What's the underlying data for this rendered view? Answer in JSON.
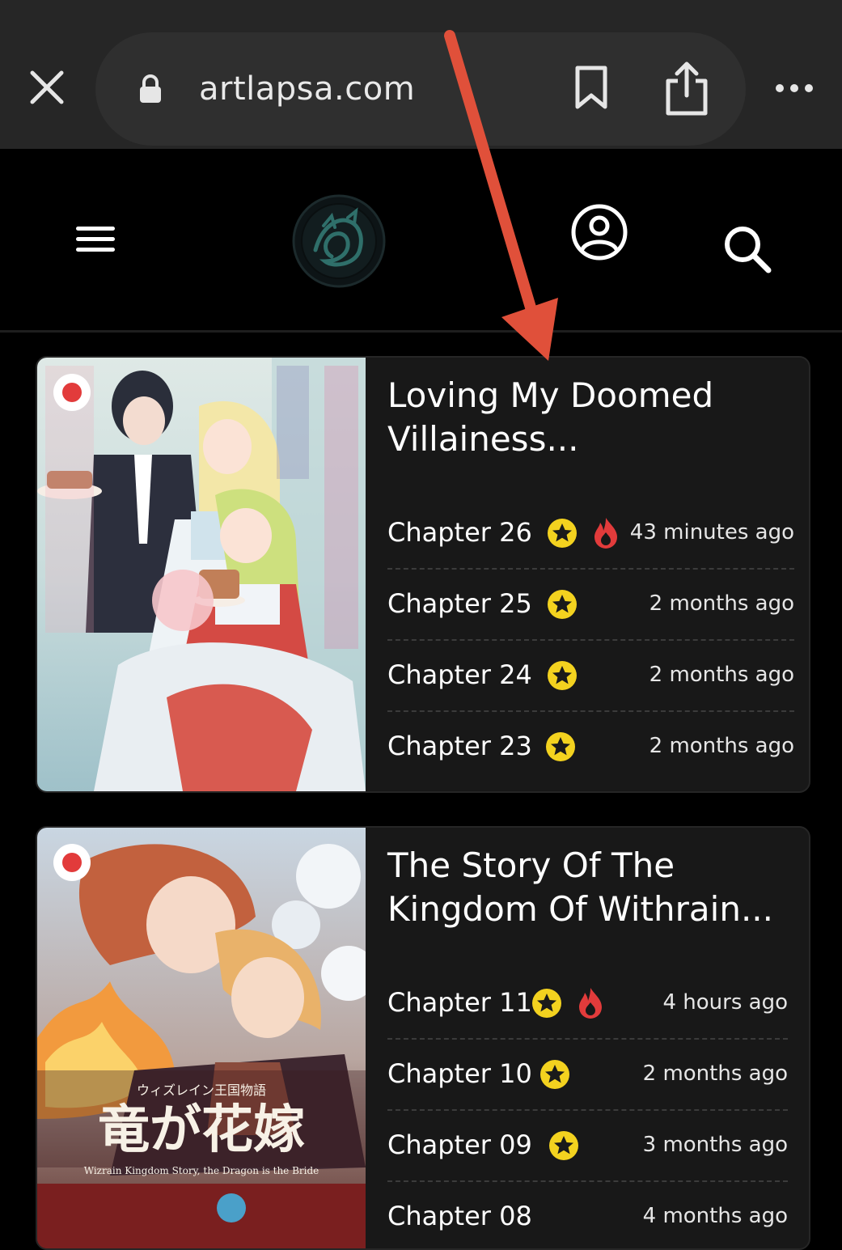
{
  "browser": {
    "url": "artlapsa.com",
    "close_icon": "close-icon",
    "lock_icon": "lock-icon",
    "bookmark_icon": "bookmark-icon",
    "share_icon": "share-icon",
    "more_icon": "more-options-icon"
  },
  "header": {
    "menu_icon": "hamburger-menu-icon",
    "logo_icon": "site-logo",
    "account_icon": "user-account-icon",
    "search_icon": "search-icon"
  },
  "colors": {
    "page_background": "#000000",
    "card_background": "#181818",
    "star_badge": "#f3d21f",
    "hot_icon": "#e23b3b",
    "annotation_arrow": "#e0503a",
    "flag_red": "#e23b3b"
  },
  "manga": [
    {
      "title": "Loving My Doomed Villainess...",
      "title_line1": "Loving My Doomed",
      "title_line2": "Villainess...",
      "chapters": [
        {
          "label": "Chapter 26",
          "time": "43 minutes ago",
          "hot": true
        },
        {
          "label": "Chapter 25",
          "time": "2 months ago",
          "hot": false
        },
        {
          "label": "Chapter 24",
          "time": "2 months ago",
          "hot": false
        },
        {
          "label": "Chapter 23",
          "time": "2 months ago",
          "hot": false
        }
      ]
    },
    {
      "title": "The Story Of The Kingdom Of Withrain...",
      "title_line1": "The Story Of The",
      "title_line2": "Kingdom Of Withrain...",
      "chapters": [
        {
          "label": "Chapter 11",
          "time": "4 hours ago",
          "hot": true
        },
        {
          "label": "Chapter 10",
          "time": "2 months ago",
          "hot": false
        },
        {
          "label": "Chapter 09",
          "time": "3 months ago",
          "hot": false
        },
        {
          "label": "Chapter 08",
          "time": "4 months ago",
          "hot": false
        }
      ]
    }
  ]
}
